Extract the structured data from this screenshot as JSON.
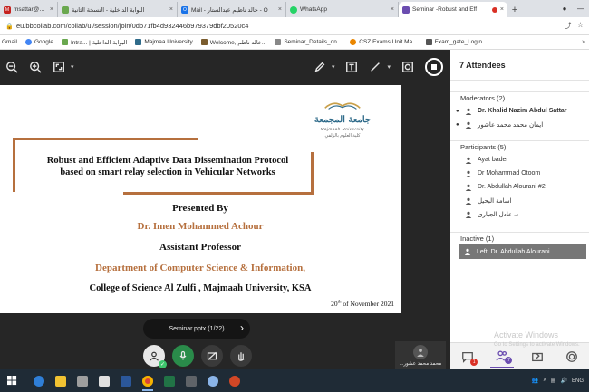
{
  "browser": {
    "tabs": [
      {
        "label": "msattar@gmail...",
        "favicon_color": "#c5221f",
        "favicon_letter": "M",
        "active": false
      },
      {
        "label": "البوابة الداخلية - النسخة الثانية",
        "favicon_color": "#6aa84f",
        "favicon_letter": "",
        "active": false
      },
      {
        "label": "Mail - خالد ناظيم عبدالستار - O",
        "favicon_color": "#1a73e8",
        "favicon_letter": "O",
        "active": false
      },
      {
        "label": "WhatsApp",
        "favicon_color": "#25d366",
        "favicon_letter": "",
        "active": false
      },
      {
        "label": "Seminar -Robust and Eff",
        "favicon_color": "#6b4db0",
        "favicon_letter": "",
        "active": true
      }
    ],
    "url": "eu.bbcollab.com/collab/ui/session/join/0db71fb4d932446b979379dbf20520c4",
    "bookmarks": [
      {
        "label": "Gmail",
        "color": "#c5221f"
      },
      {
        "label": "Google",
        "color": "#4285f4"
      },
      {
        "label": "Intra... | البوابة الداخلية",
        "color": "#6aa84f"
      },
      {
        "label": "Majmaa University",
        "color": "#2f6b8a"
      },
      {
        "label": "Welcome, خالد ناظم...",
        "color": "#7a5c2e"
      },
      {
        "label": "Seminar_Details_on...",
        "color": "#888888"
      },
      {
        "label": "CSZ Exams Unit Ma...",
        "color": "#ea8600"
      },
      {
        "label": "Exam_gate_Login",
        "color": "#555555"
      }
    ]
  },
  "slide": {
    "logo_ar": "جامعة المجمعة",
    "logo_en": "Majmaah University",
    "logo_college_ar": "كلية العلوم بالزلفي",
    "title_line1": "Robust and Efficient Adaptive Data Dissemination Protocol",
    "title_line2": "based on smart relay selection in Vehicular Networks",
    "presented_by": "Presented By",
    "presenter": "Dr. Imen Mohammed Achour",
    "role": "Assistant Professor",
    "department": "Department of Computer Science & Information,",
    "college": "College of Science Al Zulfi , Majmaah University, KSA",
    "date_day": "20",
    "date_suffix": "th",
    "date_rest": " of November 2021"
  },
  "file": {
    "name": "Seminar.pptx",
    "page": "(1/22)"
  },
  "self_view": {
    "name": "...محمد محمد عشور"
  },
  "attendees": {
    "header": "7 Attendees",
    "moderators_label": "Moderators (2)",
    "moderators": [
      {
        "name": "Dr. Khalid Nazim Abdul Sattar",
        "bold": true
      },
      {
        "name": "ايمان محمد محمد عاشور",
        "bold": false
      }
    ],
    "participants_label": "Participants (5)",
    "participants": [
      {
        "name": "Ayat bader"
      },
      {
        "name": "Dr Mohammad Otoom"
      },
      {
        "name": "Dr. Abdullah Alourani #2"
      },
      {
        "name": "اسامة البحيل"
      },
      {
        "name": "د. عادل الجبارى"
      }
    ],
    "inactive_label": "Inactive (1)",
    "inactive": [
      {
        "name": "Left:  Dr. Abdullah Alourani"
      }
    ],
    "chat_count": "1",
    "people_count": "7"
  },
  "watermark": {
    "line1": "Activate Windows",
    "line2": "Go to Settings to activate Windows."
  },
  "taskbar": {
    "lang": "ENG"
  },
  "colors": {
    "accent": "#b6703e",
    "purple": "#6b4db0",
    "green": "#3ec46d"
  }
}
